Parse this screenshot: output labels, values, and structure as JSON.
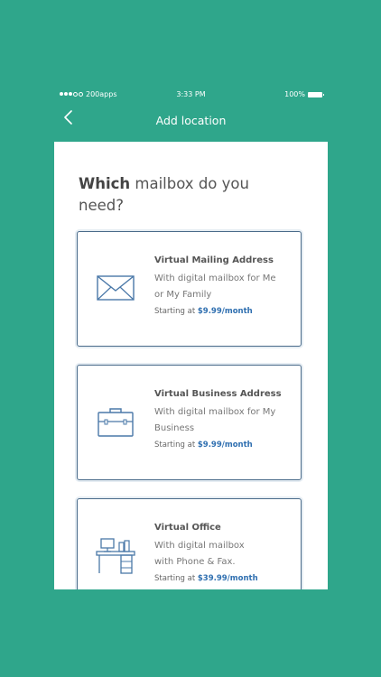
{
  "status": {
    "carrier": "200apps",
    "time": "3:33 PM",
    "battery": "100%"
  },
  "header": {
    "title": "Add location"
  },
  "heading": {
    "bold": "Which",
    "rest": "mailbox do you need?"
  },
  "cards": [
    {
      "name": "Virtual Mailing Address",
      "desc_line1": "With digital mailbox for Me",
      "desc_line2": "or My Family",
      "price_prefix": "Starting at",
      "price": "$9.99/month"
    },
    {
      "name": "Virtual Business Address",
      "desc_line1": "With digital mailbox for My",
      "desc_line2": "Business",
      "price_prefix": "Starting at",
      "price": "$9.99/month"
    },
    {
      "name": "Virtual Office",
      "desc_line1": "With digital mailbox",
      "desc_line2": "with Phone & Fax.",
      "price_prefix": "Starting at",
      "price": "$39.99/month"
    }
  ],
  "icons": {
    "back": "chevron-left-icon",
    "card1": "envelope-icon",
    "card2": "briefcase-icon",
    "card3": "desk-icon"
  },
  "colors": {
    "brand": "#2fa68b",
    "card_border": "#4a6b8a",
    "price": "#2f6fb0"
  }
}
